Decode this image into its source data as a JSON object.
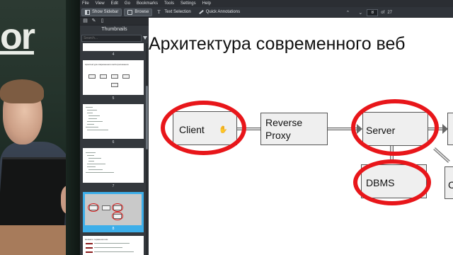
{
  "camera": {
    "chalk_text": "or"
  },
  "menubar": {
    "items": [
      "File",
      "View",
      "Edit",
      "Go",
      "Bookmarks",
      "Tools",
      "Settings",
      "Help"
    ]
  },
  "toolbar": {
    "show_sidebar": "Show Sidebar",
    "browse": "Browse",
    "text_selection": "Text Selection",
    "quick_annotations": "Quick Annotations",
    "page_current": "8",
    "page_of": "of",
    "page_total": "27"
  },
  "sidebar": {
    "title": "Thumbnails",
    "search_placeholder": "Search...",
    "thumbnails": [
      {
        "number": "4"
      },
      {
        "number": "5",
        "caption": "Архитектура современного веб-приложения"
      },
      {
        "number": "6"
      },
      {
        "number": "7"
      },
      {
        "number": "8",
        "selected": true
      },
      {
        "number": "",
        "caption": "Немного терминологии"
      }
    ]
  },
  "slide": {
    "title": "Архитектура современного веб",
    "nodes": {
      "client": "Client",
      "reverse_proxy_line1": "Reverse",
      "reverse_proxy_line2": "Proxy",
      "server": "Server",
      "dbms": "DBMS",
      "partial_c": "C"
    }
  },
  "colors": {
    "highlight_red": "#e8161a",
    "selection_blue": "#3daee9"
  }
}
